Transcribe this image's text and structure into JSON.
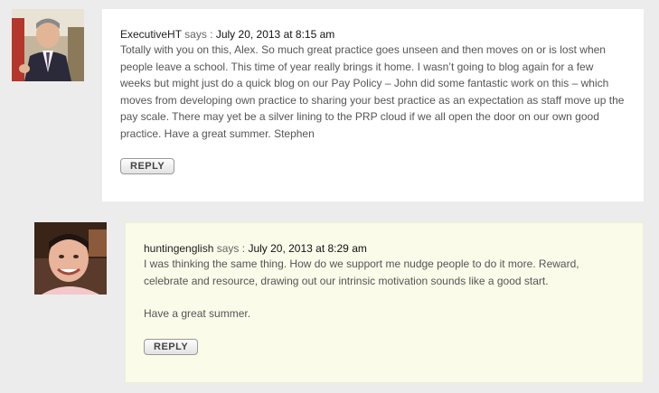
{
  "comments": [
    {
      "author": "ExecutiveHT",
      "says": "says : ",
      "date": "July 20, 2013 at 8:15 am",
      "paragraphs": [
        "Totally with you on this, Alex. So much great practice goes unseen and then moves on or is lost when people leave a school. This time of year really brings it home. I wasn’t going to blog again for a few weeks but might just do a quick blog on our Pay Policy – John did some fantastic work on this – which moves from developing own practice to sharing your best practice as an expectation as staff move up the pay scale. There may yet be a silver lining to the PRP cloud if we all open the door on our own good practice. Have a great summer. Stephen"
      ],
      "reply_label": "REPLY"
    },
    {
      "author": "huntingenglish",
      "says": "says : ",
      "date": "July 20, 2013 at 8:29 am",
      "paragraphs": [
        "I was thinking the same thing. How do we support me nudge people to do it more. Reward, celebrate and resource, drawing out our intrinsic motivation sounds like a good start.",
        "Have a great summer."
      ],
      "reply_label": "REPLY"
    }
  ],
  "colors": {
    "page_bg": "#ececec",
    "box_white": "#ffffff",
    "box_cream": "#fbfbea"
  },
  "icons": {
    "avatar_1": "avatar-man-suit",
    "avatar_2": "avatar-man-smiling"
  }
}
